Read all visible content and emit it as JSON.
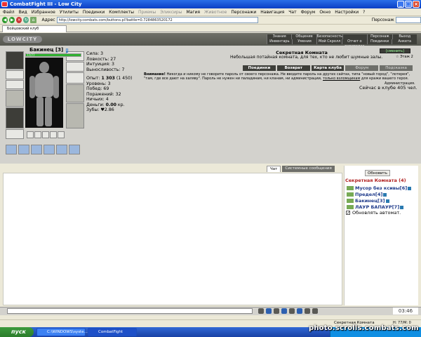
{
  "window": {
    "title": "CombatFight III - Low City"
  },
  "menu": [
    "Файл",
    "Вид",
    "Избранное",
    "Утилиты",
    "Поединки",
    "Комплекты",
    "Приемы",
    "Эликсиры",
    "Магия",
    "Животное",
    "Персонажи",
    "Навигация",
    "Чат",
    "Форум",
    "Окно",
    "Настройки",
    "?"
  ],
  "menu_dim": [
    6,
    7,
    9
  ],
  "address": {
    "label": "Адрес",
    "url": "http://lowcity.combats.com/buttons.pl?battle=0.7284863520172",
    "search_label": "Персонаж"
  },
  "tab": {
    "label": "Бойцовский клуб"
  },
  "game": {
    "logo": "LOWCITY",
    "topnav_row1": [
      "Знания",
      "Общение",
      "Безопасность",
      "",
      "Персонаж",
      "Выход"
    ],
    "topnav_row2": [
      "Инвентарь",
      "Умения",
      "Мой Скролл",
      "Отчет о переводах",
      "Поединки",
      "Анкета"
    ]
  },
  "character": {
    "name": "Бакинец",
    "level": "[3]",
    "hp_text": "77/77",
    "hp_percent": 100,
    "stats": {
      "sila": "Сила: 3",
      "lovk": "Ловкость: 27",
      "int": "Интуиция: 3",
      "vyn": "Выносливость: 7",
      "exp_label": "Опыт:",
      "exp_value": "1 303",
      "exp_next": "(1 450)",
      "level_line": "Уровень: 3",
      "wins": "Побед: 69",
      "losses": "Поражений: 32",
      "draws": "Ничьих: 4",
      "money_label": "Деньги:",
      "money_value": "0.00",
      "money_unit": "кр.",
      "teeth": "Зубы: ♥2.86"
    }
  },
  "room": {
    "title": "Секретная Комната",
    "desc": "Небольшая потайная комната, для тех, кто не любит шумные залы.",
    "tag": "[сменить]",
    "cap": "☆ Этаж 2",
    "actions": [
      "Поединки",
      "Возврат",
      "Карта клуба",
      "Форум",
      "Подсказка"
    ],
    "warning_bold": "Внимание!",
    "warning": "Никогда и никому не говорите пароль от своего персонажа. Не вводите пароль на других сайтах, типа \"новый город\", \"лотерея\", \"там, где все дают на халяву\". Пароль не нужен ни паладинам, ни кланам, ни администрации,",
    "warning_link": "только взломщикам",
    "warning_end": "для кражи вашего героя.",
    "admin": "Администрация.",
    "online": "Сейчас в клубе 405 чел."
  },
  "chat": {
    "tabs": [
      "Чат",
      "Системные сообщения"
    ]
  },
  "users": {
    "refresh": "Обновить",
    "room_head": "Секретная Комната (4)",
    "list": [
      {
        "name": "Мусор без ксивы",
        "lvl": "[6]"
      },
      {
        "name": "Предел",
        "lvl": "[4]"
      },
      {
        "name": "Бакинец",
        "lvl": "[3]"
      },
      {
        "name": "ЛАУР БАПАУР",
        "lvl": "[7]"
      }
    ],
    "auto": "Обновлять автомат."
  },
  "clock": "03:46",
  "status": {
    "text": "Секретная Комната",
    "mem": "H: 77/M: 0"
  },
  "taskbar": {
    "start": "пуск",
    "tasks": [
      "C:\\WINDOWS\\syste...",
      "CombatFight"
    ]
  },
  "watermark": "photo.scrolls.combats.com"
}
